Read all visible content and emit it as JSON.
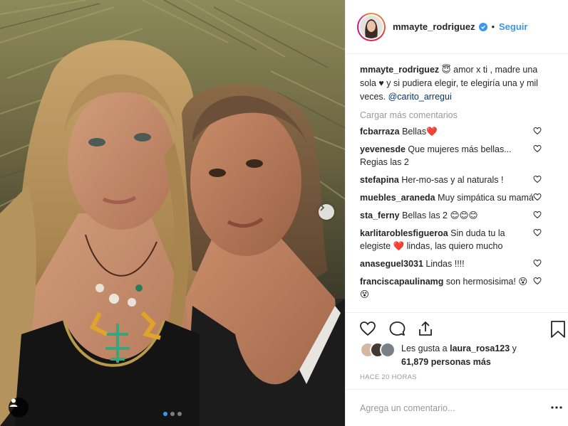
{
  "post": {
    "username": "mmayte_rodriguez",
    "follow_label": "Seguir",
    "separator": "•",
    "caption_user": "mmayte_rodriguez",
    "caption_text": " 😇 amor x ti , madre una sola ♥ y si pudiera elegir, te elegiría una y mil veces. ",
    "caption_mention": "@carito_arregui",
    "load_more_label": "Cargar más comentarios"
  },
  "comments": [
    {
      "user": "fcbarraza",
      "text": " Bellas❤️"
    },
    {
      "user": "yevenesde",
      "text": " Que mujeres más bellas... Regias las 2"
    },
    {
      "user": "stefapina",
      "text": " Her-mo-sas y al naturals !"
    },
    {
      "user": "muebles_araneda",
      "text": " Muy simpática su mamá"
    },
    {
      "user": "sta_ferny",
      "text": " Bellas las 2 😊😊😊"
    },
    {
      "user": "karlitaroblesfigueroa",
      "text": " Sin duda tu la elegiste ❤️ lindas, las quiero mucho"
    },
    {
      "user": "anaseguel3031",
      "text": " Lindas !!!!"
    },
    {
      "user": "franciscapaulinamg",
      "text": " son hermosisima! 😵😵"
    }
  ],
  "likes": {
    "prefix": "Les gusta a ",
    "user": "laura_rosa123",
    "middle": " y ",
    "count": "61,879 personas más"
  },
  "timestamp": "HACE 20 HORAS",
  "add_comment": {
    "placeholder": "Agrega un comentario..."
  },
  "icons": {
    "heart": "heart-icon",
    "comment": "comment-icon",
    "share": "share-icon",
    "bookmark": "bookmark-icon",
    "verified": "verified-badge-icon",
    "next": "chevron-right-icon",
    "user_tag": "user-tag-icon",
    "more": "more-options-icon"
  },
  "colors": {
    "accent": "#3897f0",
    "like_heart": "#ed4956",
    "muted": "#999999",
    "text": "#262626"
  }
}
